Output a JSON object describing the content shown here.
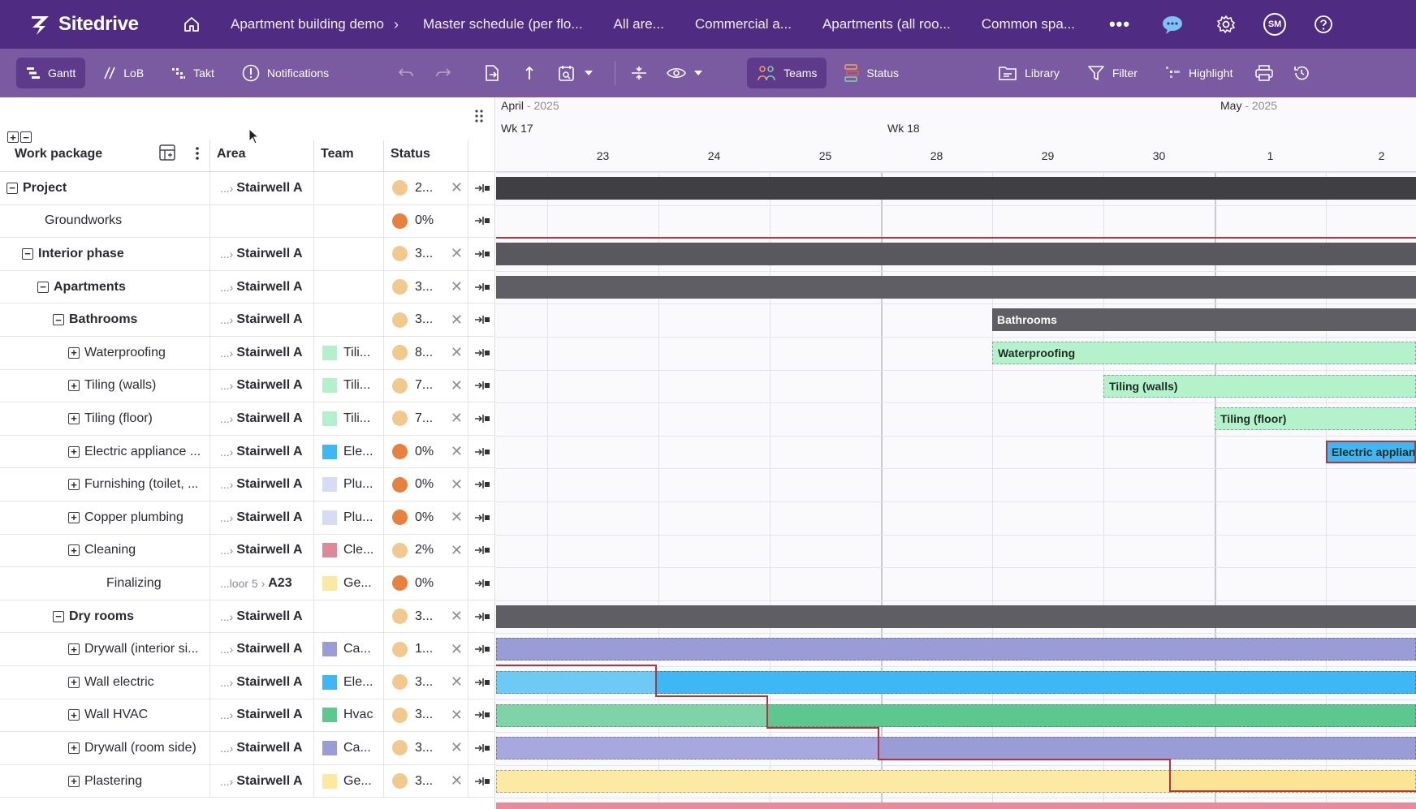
{
  "app": {
    "name": "Sitedrive",
    "breadcrumbs": [
      "Apartment building demo",
      "Master schedule (per flo...",
      "All are...",
      "Commercial a...",
      "Apartments (all roo...",
      "Common spa..."
    ],
    "more_label": "•••",
    "avatar_initials": "SM"
  },
  "toolbar": {
    "gantt": "Gantt",
    "lob": "LoB",
    "takt": "Takt",
    "notifications": "Notifications",
    "teams": "Teams",
    "status": "Status",
    "library": "Library",
    "filter": "Filter",
    "highlight": "Highlight"
  },
  "grid": {
    "headers": {
      "work_package": "Work package",
      "area": "Area",
      "team": "Team",
      "status": "Status"
    },
    "rows": [
      {
        "name": "Project",
        "level": 0,
        "toggle": "−",
        "bold": true,
        "area_pre": "...›",
        "area": "Stairwell A",
        "team": "",
        "team_color": "",
        "status": "2...",
        "status_color": "#f2c98c",
        "x": "✕"
      },
      {
        "name": "Groundworks",
        "level": 1,
        "toggle": "",
        "bold": false,
        "area_pre": "",
        "area": "",
        "team": "",
        "team_color": "",
        "status": "0%",
        "status_color": "#e8803e",
        "x": ""
      },
      {
        "name": "Interior phase",
        "level": 1,
        "toggle": "−",
        "bold": true,
        "area_pre": "...›",
        "area": "Stairwell A",
        "team": "",
        "team_color": "",
        "status": "3...",
        "status_color": "#f2c98c",
        "x": "✕"
      },
      {
        "name": "Apartments",
        "level": 2,
        "toggle": "−",
        "bold": true,
        "area_pre": "...›",
        "area": "Stairwell A",
        "team": "",
        "team_color": "",
        "status": "3...",
        "status_color": "#f2c98c",
        "x": "✕"
      },
      {
        "name": "Bathrooms",
        "level": 3,
        "toggle": "−",
        "bold": true,
        "area_pre": "...›",
        "area": "Stairwell A",
        "team": "",
        "team_color": "",
        "status": "3...",
        "status_color": "#f2c98c",
        "x": "✕"
      },
      {
        "name": "Waterproofing",
        "level": 4,
        "toggle": "+",
        "bold": false,
        "area_pre": "...›",
        "area": "Stairwell A",
        "team": "Tili...",
        "team_color": "#b5f0cc",
        "status": "8...",
        "status_color": "#f2c98c",
        "x": "✕"
      },
      {
        "name": "Tiling (walls)",
        "level": 4,
        "toggle": "+",
        "bold": false,
        "area_pre": "...›",
        "area": "Stairwell A",
        "team": "Tili...",
        "team_color": "#b5f0cc",
        "status": "7...",
        "status_color": "#f2c98c",
        "x": "✕"
      },
      {
        "name": "Tiling (floor)",
        "level": 4,
        "toggle": "+",
        "bold": false,
        "area_pre": "...›",
        "area": "Stairwell A",
        "team": "Tili...",
        "team_color": "#b5f0cc",
        "status": "7...",
        "status_color": "#f2c98c",
        "x": "✕"
      },
      {
        "name": "Electric appliance ...",
        "level": 4,
        "toggle": "+",
        "bold": false,
        "area_pre": "...›",
        "area": "Stairwell A",
        "team": "Ele...",
        "team_color": "#3db8f5",
        "status": "0%",
        "status_color": "#e8803e",
        "x": "✕"
      },
      {
        "name": "Furnishing (toilet, ...",
        "level": 4,
        "toggle": "+",
        "bold": false,
        "area_pre": "...›",
        "area": "Stairwell A",
        "team": "Plu...",
        "team_color": "#d6dcf4",
        "status": "0%",
        "status_color": "#e8803e",
        "x": "✕"
      },
      {
        "name": "Copper plumbing",
        "level": 4,
        "toggle": "+",
        "bold": false,
        "area_pre": "...›",
        "area": "Stairwell A",
        "team": "Plu...",
        "team_color": "#d6dcf4",
        "status": "0%",
        "status_color": "#e8803e",
        "x": "✕"
      },
      {
        "name": "Cleaning",
        "level": 4,
        "toggle": "+",
        "bold": false,
        "area_pre": "...›",
        "area": "Stairwell A",
        "team": "Cle...",
        "team_color": "#dc8a9a",
        "status": "2%",
        "status_color": "#f2c98c",
        "x": "✕"
      },
      {
        "name": "Finalizing",
        "level": 5,
        "toggle": "",
        "bold": false,
        "area_pre": "...loor 5 ›",
        "area": "A23",
        "team": "Ge...",
        "team_color": "#fbe9a0",
        "status": "0%",
        "status_color": "#e8803e",
        "x": ""
      },
      {
        "name": "Dry rooms",
        "level": 3,
        "toggle": "−",
        "bold": true,
        "area_pre": "...›",
        "area": "Stairwell A",
        "team": "",
        "team_color": "",
        "status": "3...",
        "status_color": "#f2c98c",
        "x": "✕"
      },
      {
        "name": "Drywall (interior si...",
        "level": 4,
        "toggle": "+",
        "bold": false,
        "area_pre": "...›",
        "area": "Stairwell A",
        "team": "Ca...",
        "team_color": "#9a9cd6",
        "status": "1...",
        "status_color": "#f2c98c",
        "x": "✕"
      },
      {
        "name": "Wall electric",
        "level": 4,
        "toggle": "+",
        "bold": false,
        "area_pre": "...›",
        "area": "Stairwell A",
        "team": "Ele...",
        "team_color": "#3db8f5",
        "status": "3...",
        "status_color": "#f2c98c",
        "x": "✕"
      },
      {
        "name": "Wall HVAC",
        "level": 4,
        "toggle": "+",
        "bold": false,
        "area_pre": "...›",
        "area": "Stairwell A",
        "team": "Hvac",
        "team_color": "#5cc88f",
        "status": "3...",
        "status_color": "#f2c98c",
        "x": "✕"
      },
      {
        "name": "Drywall (room side)",
        "level": 4,
        "toggle": "+",
        "bold": false,
        "area_pre": "...›",
        "area": "Stairwell A",
        "team": "Ca...",
        "team_color": "#9a9cd6",
        "status": "3...",
        "status_color": "#f2c98c",
        "x": "✕"
      },
      {
        "name": "Plastering",
        "level": 4,
        "toggle": "+",
        "bold": false,
        "area_pre": "...›",
        "area": "Stairwell A",
        "team": "Ge...",
        "team_color": "#fbe9a0",
        "status": "3...",
        "status_color": "#f2c98c",
        "x": "✕"
      }
    ]
  },
  "timeline": {
    "months": [
      {
        "name": "April",
        "year": "- 2025"
      },
      {
        "name": "May",
        "year": "- 2025"
      }
    ],
    "weeks": [
      "Wk 17",
      "Wk 18"
    ],
    "days": [
      "23",
      "24",
      "25",
      "28",
      "29",
      "30",
      "1",
      "2"
    ],
    "bar_labels": {
      "bathrooms": "Bathrooms",
      "waterproofing": "Waterproofing",
      "tiling_walls": "Tiling (walls)",
      "tiling_floor": "Tiling (floor)",
      "electric": "Electric applian"
    }
  }
}
